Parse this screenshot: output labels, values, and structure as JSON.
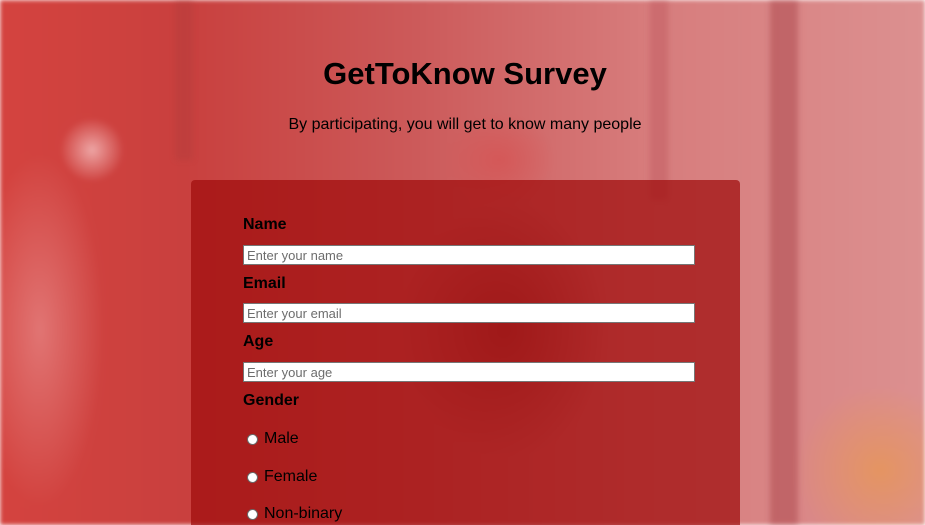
{
  "page": {
    "title": "GetToKnow Survey",
    "subtitle": "By participating, you will get to know many people"
  },
  "form": {
    "name": {
      "label": "Name",
      "placeholder": "Enter your name",
      "value": ""
    },
    "email": {
      "label": "Email",
      "placeholder": "Enter your email",
      "value": ""
    },
    "age": {
      "label": "Age",
      "placeholder": "Enter your age",
      "value": ""
    },
    "gender": {
      "label": "Gender",
      "options": [
        {
          "label": "Male",
          "checked": false
        },
        {
          "label": "Female",
          "checked": false
        },
        {
          "label": "Non-binary",
          "checked": false
        }
      ]
    }
  },
  "colors": {
    "card_background": "#a00c0c",
    "background_tint": "#d4433f"
  }
}
